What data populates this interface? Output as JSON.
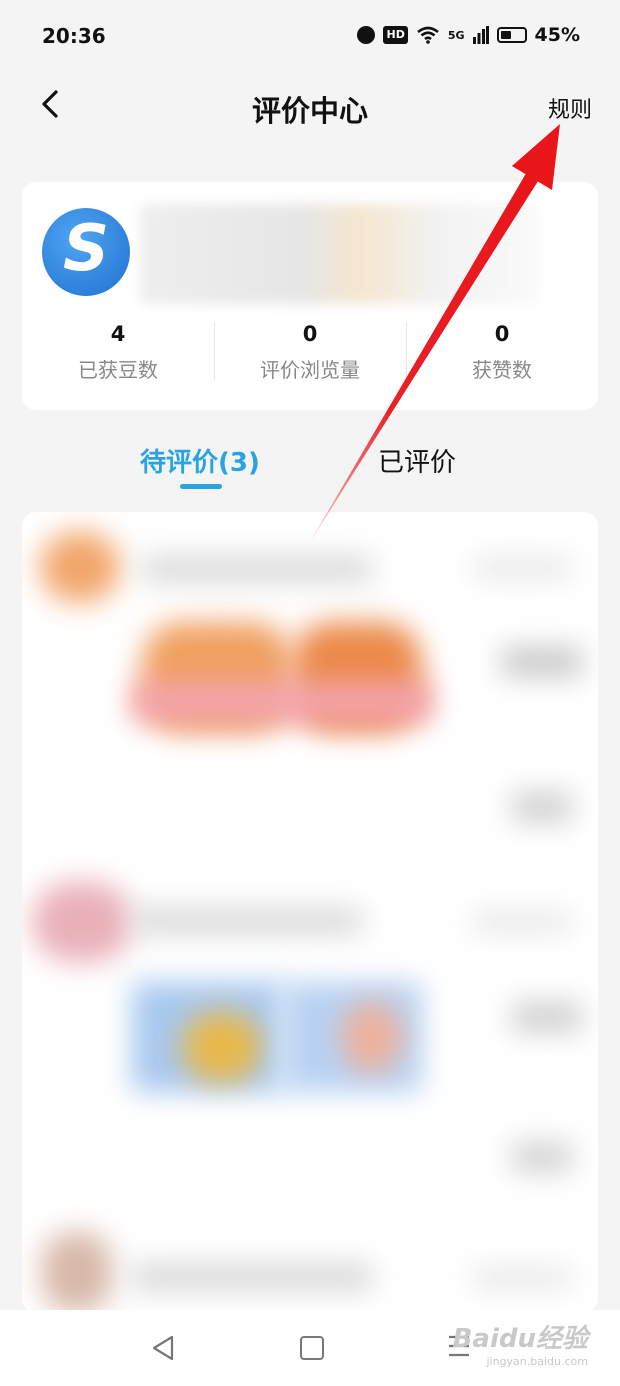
{
  "status_bar": {
    "time": "20:36",
    "hd": "HD",
    "network": "5G",
    "battery_pct": "45%",
    "battery_level": 0.45,
    "icons": [
      "alarm-icon",
      "hd-badge",
      "wifi-icon",
      "signal-icon",
      "battery-icon"
    ]
  },
  "header": {
    "back_icon": "chevron-left-icon",
    "title": "评价中心",
    "rules_label": "规则"
  },
  "profile": {
    "avatar_letter": "S",
    "stats": [
      {
        "value": "4",
        "label": "已获豆数"
      },
      {
        "value": "0",
        "label": "评价浏览量"
      },
      {
        "value": "0",
        "label": "获赞数"
      }
    ]
  },
  "tabs": [
    {
      "label": "待评价(3)",
      "active": true
    },
    {
      "label": "已评价",
      "active": false
    }
  ],
  "colors": {
    "accent": "#2aa3e0",
    "annotation_arrow": "#e8151b"
  },
  "nav": {
    "icons": [
      "nav-back-icon",
      "nav-home-icon",
      "nav-menu-icon"
    ]
  },
  "watermark": {
    "logo": "Baidu经验",
    "sub": "jingyan.baidu.com"
  }
}
